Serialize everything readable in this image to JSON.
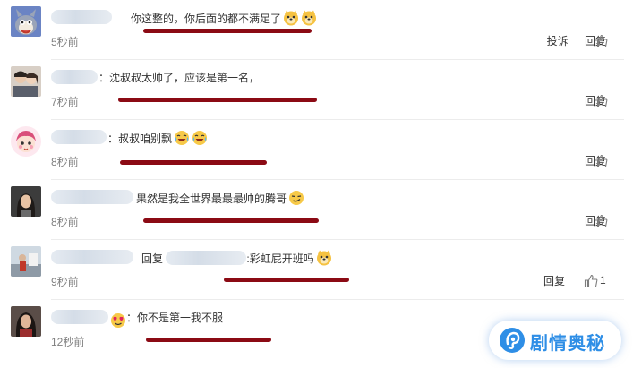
{
  "comments": [
    {
      "avatar_icon": "tom-cat-avatar-icon",
      "text": "你这整的，你后面的都不满足了",
      "emoji": [
        "doge-emoji-icon",
        "doge-emoji-icon"
      ],
      "time": "5秒前",
      "report": "投诉",
      "reply": "回复"
    },
    {
      "avatar_icon": "couple-photo-avatar-icon",
      "text": "：沈叔叔太帅了，应该是第一名，",
      "emoji": [],
      "time": "7秒前",
      "reply": "回复"
    },
    {
      "avatar_icon": "cartoon-girl-avatar-icon",
      "text": "：叔叔咱别飘",
      "emoji": [
        "laugh-cry-emoji-icon",
        "laugh-cry-emoji-icon"
      ],
      "time": "8秒前",
      "reply": "回复"
    },
    {
      "avatar_icon": "long-hair-person-avatar-icon",
      "text": "果然是我全世界最最最帅的腾哥",
      "emoji": [
        "smirk-emoji-icon"
      ],
      "time": "8秒前",
      "reply": "回复"
    },
    {
      "avatar_icon": "outdoor-photo-avatar-icon",
      "reply_prefix": "回复",
      "text": ":彩虹屁开班吗",
      "emoji": [
        "doge-emoji-icon"
      ],
      "time": "9秒前",
      "reply": "回复",
      "like_count": "1"
    },
    {
      "avatar_icon": "dark-hair-person-avatar-icon",
      "text": "：你不是第一我不服",
      "emoji": [],
      "name_emoji": "heart-eyes-emoji-icon",
      "time": "12秒前"
    }
  ],
  "watermark": {
    "text": "剧情奥秘",
    "icon": "ear-logo-icon"
  },
  "colors": {
    "underline": "#8b0a14",
    "watermark": "#2e8ee6",
    "time": "#808080"
  }
}
